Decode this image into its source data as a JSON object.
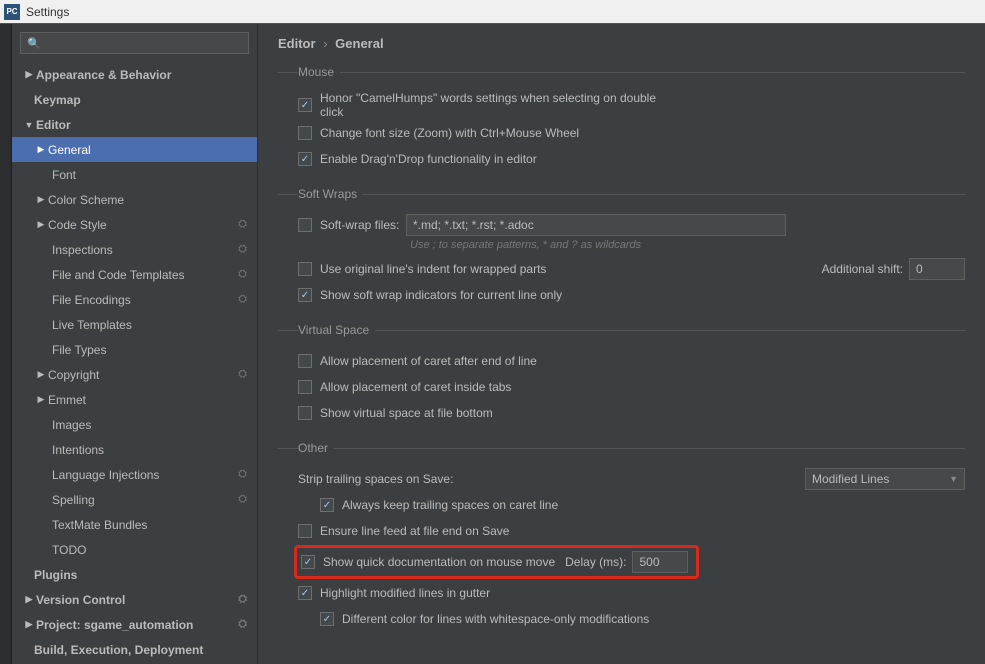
{
  "window": {
    "title": "Settings",
    "appicon_label": "PC"
  },
  "search": {
    "placeholder": ""
  },
  "tree": {
    "appearance": "Appearance & Behavior",
    "keymap": "Keymap",
    "editor": "Editor",
    "general": "General",
    "font": "Font",
    "color_scheme": "Color Scheme",
    "code_style": "Code Style",
    "inspections": "Inspections",
    "file_code_templates": "File and Code Templates",
    "file_encodings": "File Encodings",
    "live_templates": "Live Templates",
    "file_types": "File Types",
    "copyright": "Copyright",
    "emmet": "Emmet",
    "images": "Images",
    "intentions": "Intentions",
    "language_injections": "Language Injections",
    "spelling": "Spelling",
    "textmate_bundles": "TextMate Bundles",
    "todo": "TODO",
    "plugins": "Plugins",
    "version_control": "Version Control",
    "project": "Project: sgame_automation",
    "build": "Build, Execution, Deployment"
  },
  "breadcrumb": {
    "a": "Editor",
    "b": "General"
  },
  "mouse": {
    "legend": "Mouse",
    "honor": "Honor \"CamelHumps\" words settings when selecting on double click",
    "zoom": "Change font size (Zoom) with Ctrl+Mouse Wheel",
    "dnd": "Enable Drag'n'Drop functionality in editor"
  },
  "softwraps": {
    "legend": "Soft Wraps",
    "files_label": "Soft-wrap files:",
    "files_value": "*.md; *.txt; *.rst; *.adoc",
    "hint": "Use ; to separate patterns, * and ? as wildcards",
    "orig_indent": "Use original line's indent for wrapped parts",
    "additional_shift": "Additional shift:",
    "shift_value": "0",
    "indicators": "Show soft wrap indicators for current line only"
  },
  "virtual": {
    "legend": "Virtual Space",
    "caret_eol": "Allow placement of caret after end of line",
    "caret_tabs": "Allow placement of caret inside tabs",
    "file_bottom": "Show virtual space at file bottom"
  },
  "other": {
    "legend": "Other",
    "strip_label": "Strip trailing spaces on Save:",
    "strip_value": "Modified Lines",
    "always_keep": "Always keep trailing spaces on caret line",
    "ensure_lf": "Ensure line feed at file end on Save",
    "quick_doc": "Show quick documentation on mouse move",
    "delay_label": "Delay (ms):",
    "delay_value": "500",
    "highlight_gutter": "Highlight modified lines in gutter",
    "diff_color": "Different color for lines with whitespace-only modifications"
  }
}
